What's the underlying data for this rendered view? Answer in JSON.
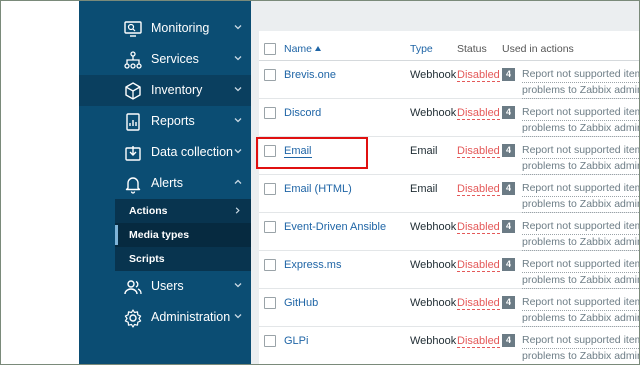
{
  "sidebar": {
    "items": [
      {
        "label": "Monitoring",
        "icon": "monitor-icon",
        "chevron": "down"
      },
      {
        "label": "Services",
        "icon": "hierarchy-icon",
        "chevron": "down"
      },
      {
        "label": "Inventory",
        "icon": "cube-icon",
        "chevron": "down"
      },
      {
        "label": "Reports",
        "icon": "report-icon",
        "chevron": "down"
      },
      {
        "label": "Data collection",
        "icon": "download-icon",
        "chevron": "down"
      },
      {
        "label": "Alerts",
        "icon": "bell-icon",
        "chevron": "up"
      },
      {
        "label": "Users",
        "icon": "users-icon",
        "chevron": "down"
      },
      {
        "label": "Administration",
        "icon": "gear-icon",
        "chevron": "down"
      }
    ],
    "alerts_sub": [
      {
        "label": "Actions",
        "chevron": "right"
      },
      {
        "label": "Media types"
      },
      {
        "label": "Scripts"
      }
    ]
  },
  "table": {
    "headers": {
      "name": "Name",
      "type": "Type",
      "status": "Status",
      "used": "Used in actions"
    },
    "rows": [
      {
        "name": "Brevis.one",
        "type": "Webhook",
        "status": "Disabled",
        "count": "4",
        "action1": "Report not supported items,",
        "action2": "problems to Zabbix administ"
      },
      {
        "name": "Discord",
        "type": "Webhook",
        "status": "Disabled",
        "count": "4",
        "action1": "Report not supported items,",
        "action2": "problems to Zabbix administ"
      },
      {
        "name": "Email",
        "type": "Email",
        "status": "Disabled",
        "count": "4",
        "action1": "Report not supported items,",
        "action2": "problems to Zabbix administ"
      },
      {
        "name": "Email (HTML)",
        "type": "Email",
        "status": "Disabled",
        "count": "4",
        "action1": "Report not supported items,",
        "action2": "problems to Zabbix administ"
      },
      {
        "name": "Event-Driven Ansible",
        "type": "Webhook",
        "status": "Disabled",
        "count": "4",
        "action1": "Report not supported items,",
        "action2": "problems to Zabbix administ"
      },
      {
        "name": "Express.ms",
        "type": "Webhook",
        "status": "Disabled",
        "count": "4",
        "action1": "Report not supported items,",
        "action2": "problems to Zabbix administ"
      },
      {
        "name": "GitHub",
        "type": "Webhook",
        "status": "Disabled",
        "count": "4",
        "action1": "Report not supported items,",
        "action2": "problems to Zabbix administ"
      },
      {
        "name": "GLPi",
        "type": "Webhook",
        "status": "Disabled",
        "count": "4",
        "action1": "Report not supported items,",
        "action2": "problems to Zabbix administ"
      }
    ]
  },
  "colors": {
    "sidebar": "#0b4d73",
    "link": "#1f65a6",
    "disabled": "#e45959",
    "highlight": "#e01010"
  }
}
